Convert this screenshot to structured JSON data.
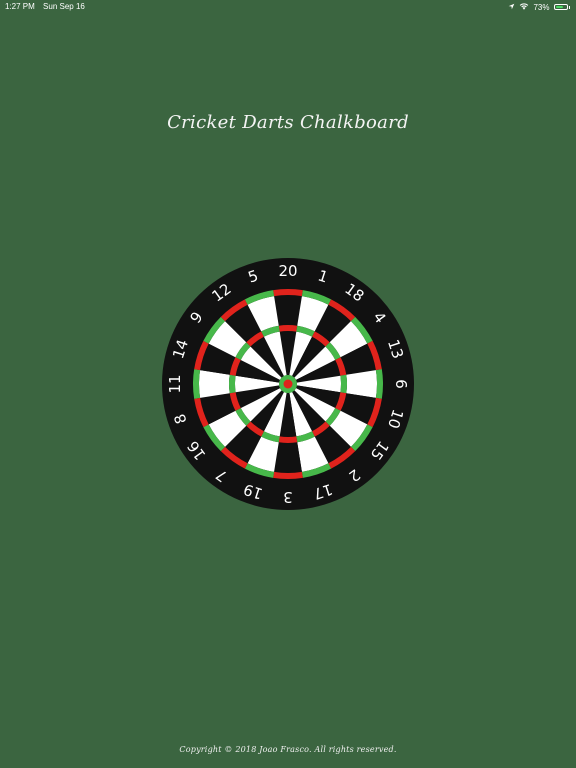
{
  "status_bar": {
    "time": "1:27 PM",
    "date": "Sun Sep 16",
    "battery_percent": "73%",
    "battery_level": 0.73,
    "wifi_icon": "wifi-icon",
    "location_icon": "location-arrow-icon",
    "battery_icon": "battery-icon"
  },
  "title": "Cricket Darts Chalkboard",
  "dartboard": {
    "numbers": [
      "20",
      "1",
      "18",
      "4",
      "13",
      "6",
      "10",
      "15",
      "2",
      "17",
      "3",
      "19",
      "7",
      "16",
      "8",
      "11",
      "14",
      "9",
      "12",
      "5"
    ],
    "colors": {
      "background": "#3b6540",
      "outer_ring": "#111111",
      "segment_dark": "#111111",
      "segment_light": "#ffffff",
      "ring_red": "#e0231c",
      "ring_green": "#47b84a",
      "bull": "#e0231c",
      "outer_bull": "#47b84a"
    }
  },
  "footer": {
    "copyright": "Copyright © 2018 Joao Frasco. All rights reserved."
  }
}
